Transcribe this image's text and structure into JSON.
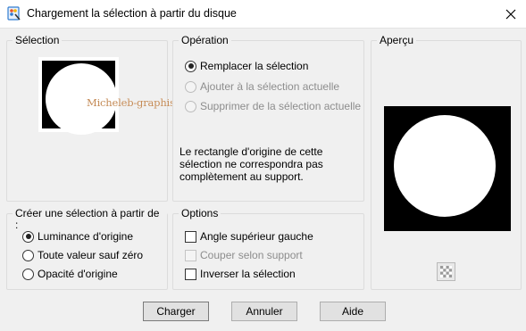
{
  "window": {
    "title": "Chargement la sélection à partir du disque",
    "close_icon": "close-icon",
    "app_icon": "paintshop-icon"
  },
  "selection_group": {
    "title": "Sélection",
    "watermark": "Micheleb-graphisme"
  },
  "operation_group": {
    "title": "Opération",
    "options": [
      {
        "label": "Remplacer la sélection",
        "checked": true,
        "enabled": true
      },
      {
        "label": "Ajouter à la sélection actuelle",
        "checked": false,
        "enabled": false
      },
      {
        "label": "Supprimer de la sélection actuelle",
        "checked": false,
        "enabled": false
      }
    ],
    "note": "Le rectangle d'origine de cette sélection ne correspondra pas complètement au support."
  },
  "preview_group": {
    "title": "Aperçu",
    "toggle_icon": "checkerboard-icon"
  },
  "create_group": {
    "title": "Créer une sélection à partir de :",
    "options": [
      {
        "label": "Luminance d'origine",
        "checked": true
      },
      {
        "label": "Toute valeur sauf zéro",
        "checked": false
      },
      {
        "label": "Opacité d'origine",
        "checked": false
      }
    ]
  },
  "options_group": {
    "title": "Options",
    "items": [
      {
        "label": "Angle supérieur gauche",
        "checked": false,
        "enabled": true
      },
      {
        "label": "Couper selon support",
        "checked": false,
        "enabled": false
      },
      {
        "label": "Inverser la sélection",
        "checked": false,
        "enabled": true
      }
    ]
  },
  "buttons": {
    "load": "Charger",
    "cancel": "Annuler",
    "help": "Aide"
  },
  "colors": {
    "background": "#f0f0f0",
    "titlebar": "#ffffff",
    "button_face": "#e1e1e1",
    "disabled_text": "#8d8d8d"
  }
}
